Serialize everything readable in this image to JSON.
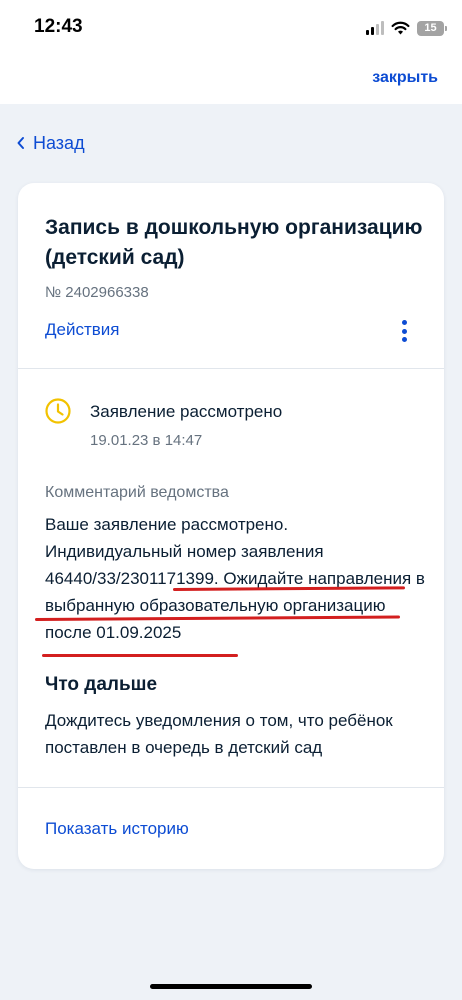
{
  "status_bar": {
    "time": "12:43",
    "battery": "15"
  },
  "header": {
    "close_label": "закрыть"
  },
  "nav": {
    "back_label": "Назад"
  },
  "card": {
    "title": "Запись в дошкольную организацию (детский сад)",
    "number": "№ 2402966338",
    "actions_label": "Действия",
    "status": {
      "icon": "clock-icon",
      "title": "Заявление рассмотрено",
      "date": "19.01.23 в 14:47"
    },
    "comment": {
      "label": "Комментарий ведомства",
      "text": "Ваше заявление рассмотрено. Индивидуальный номер заявления 46440/33/2301171399. Ожидайте направления в выбранную образовательную организацию после 01.09.2025"
    },
    "next": {
      "title": "Что дальше",
      "text": "Дождитесь уведомления о том, что ребёнок поставлен в очередь в детский сад"
    },
    "history_label": "Показать историю"
  },
  "colors": {
    "accent": "#0d4cd3",
    "status_pending": "#f2c200",
    "annotation": "#d31f1f"
  }
}
